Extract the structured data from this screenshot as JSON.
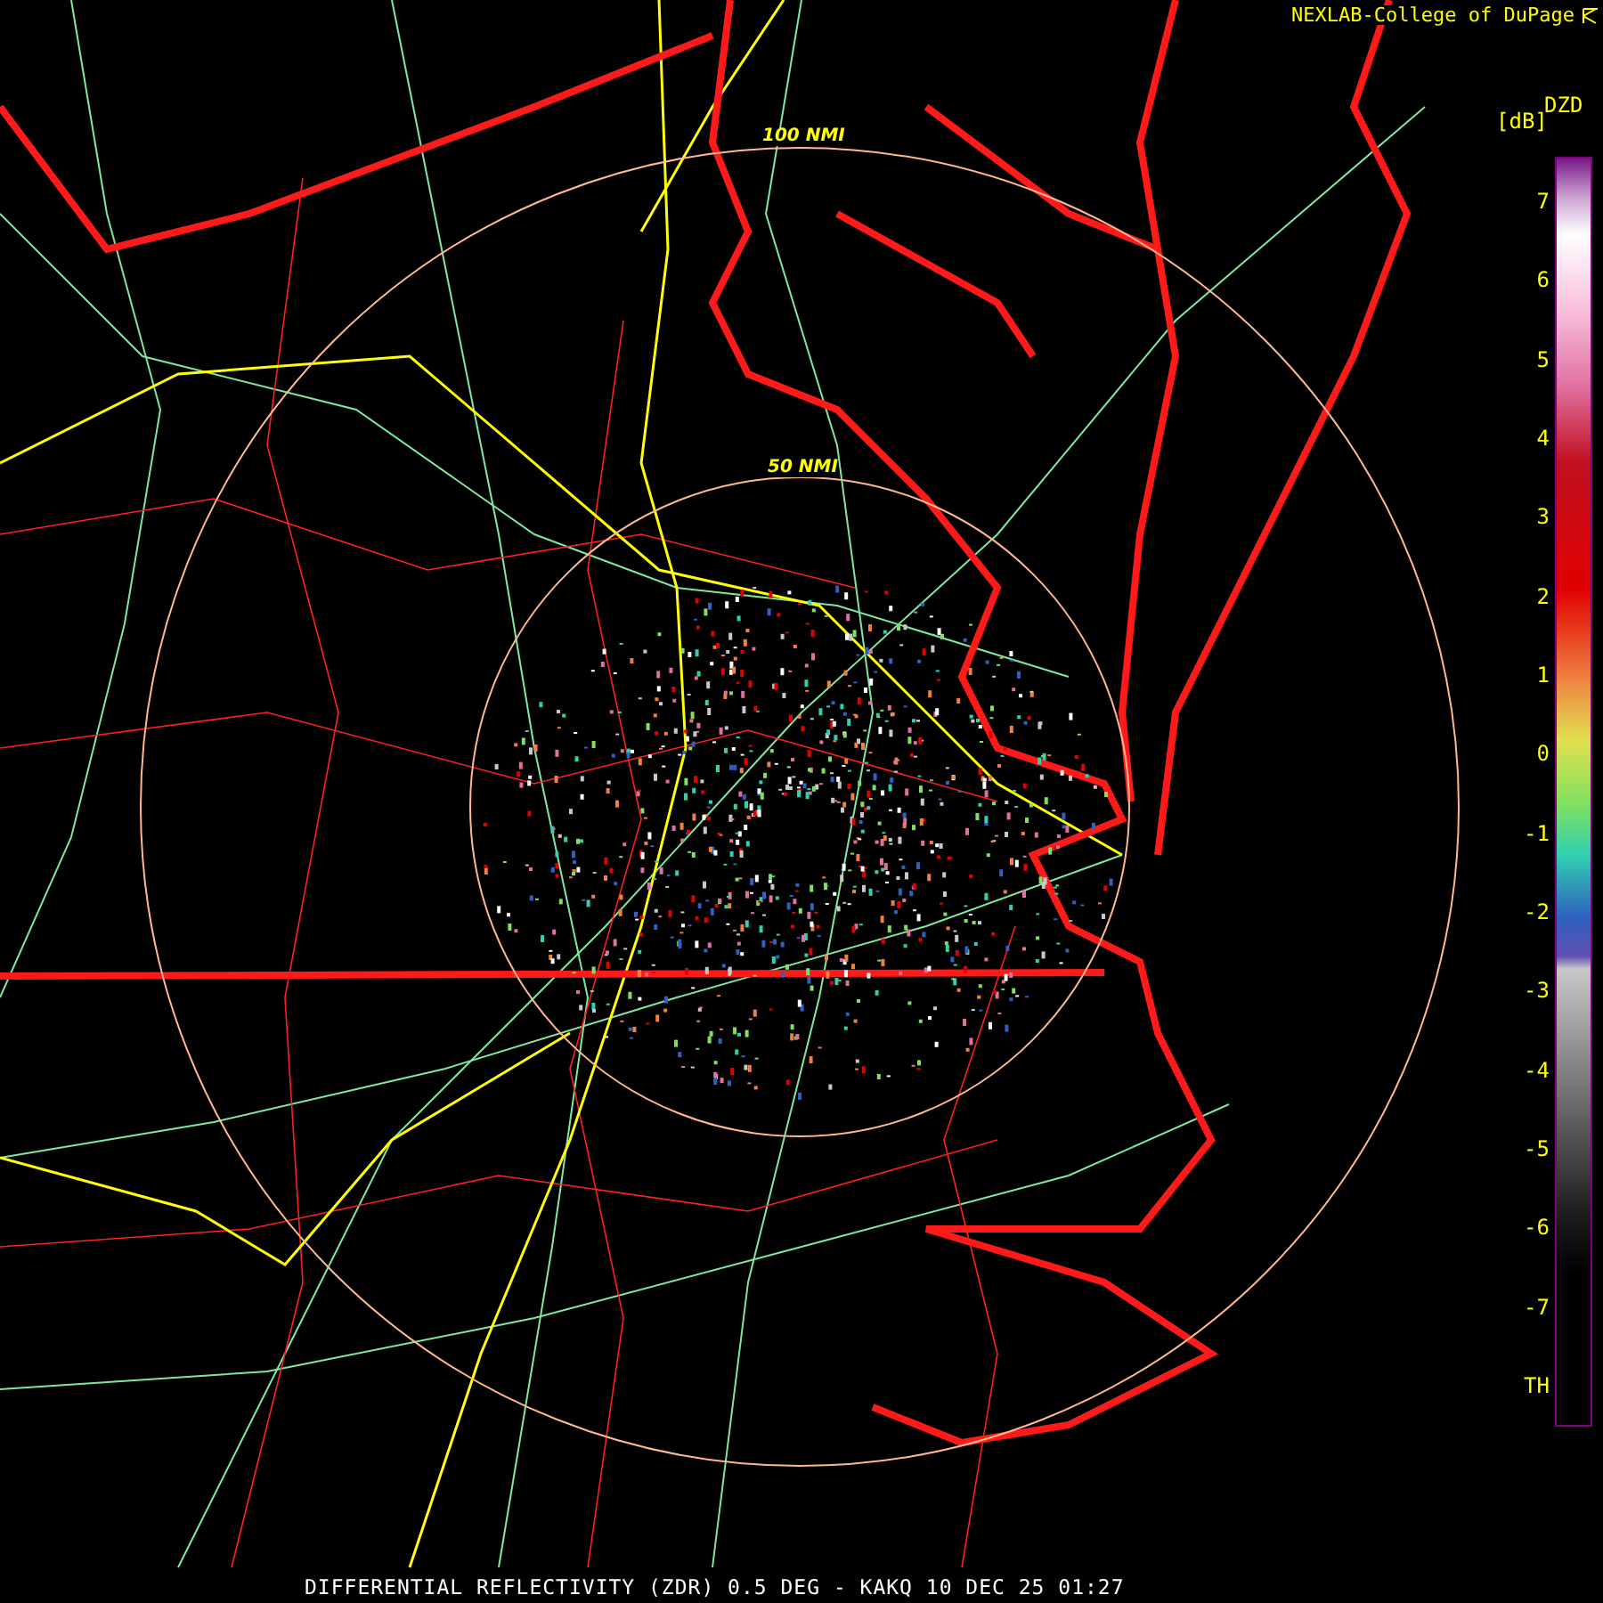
{
  "header": {
    "credit": "NEXLAB-College of DuPage"
  },
  "range_rings": [
    {
      "label": "100 NMI"
    },
    {
      "label": "50 NMI"
    }
  ],
  "legend": {
    "product": "DZD",
    "unit": "[dB]",
    "labels": [
      "7",
      "6",
      "5",
      "4",
      "3",
      "2",
      "1",
      "0",
      "-1",
      "-2",
      "-3",
      "-4",
      "-5",
      "-6",
      "-7",
      "TH"
    ]
  },
  "footer": {
    "caption": "DIFFERENTIAL REFLECTIVITY (ZDR) 0.5 DEG - KAKQ 10 DEC 25 01:27"
  }
}
